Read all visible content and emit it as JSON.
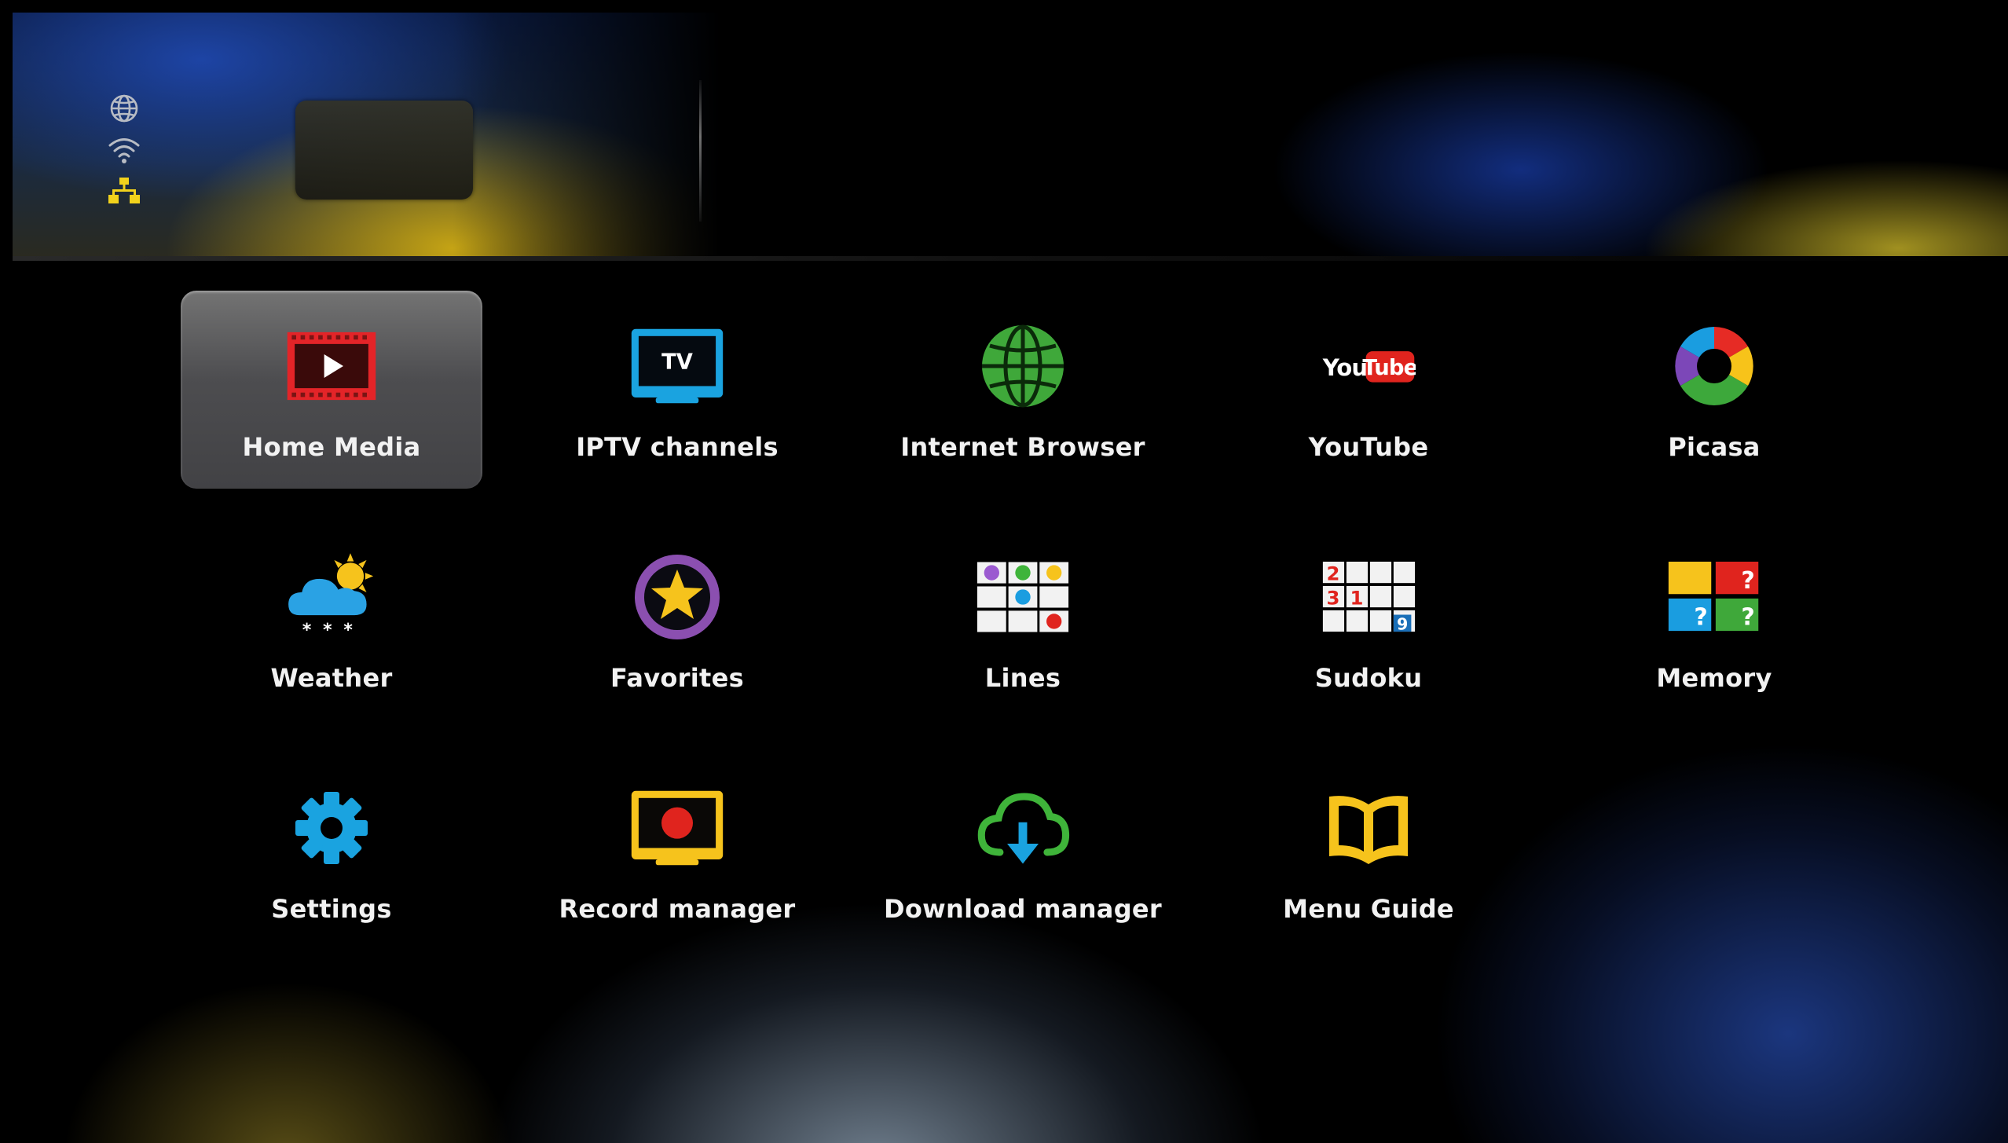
{
  "colors": {
    "background": "#000000",
    "label": "#f2f2f2",
    "status_icon_gray": "#b8bcc4",
    "status_icon_yellow": "#f2d21c"
  },
  "status_bar": {
    "icons": [
      "globe-icon",
      "wifi-icon",
      "network-icon"
    ]
  },
  "apps": [
    {
      "id": "home-media",
      "label": "Home Media",
      "icon": "film-play-icon",
      "selected": true
    },
    {
      "id": "iptv-channels",
      "label": "IPTV channels",
      "icon": "tv-icon",
      "icon_text": "TV",
      "selected": false
    },
    {
      "id": "internet-browser",
      "label": "Internet Browser",
      "icon": "globe-icon",
      "selected": false
    },
    {
      "id": "youtube",
      "label": "YouTube",
      "icon": "youtube-logo-icon",
      "icon_text": "You",
      "icon_text_2": "Tube",
      "selected": false
    },
    {
      "id": "picasa",
      "label": "Picasa",
      "icon": "picasa-logo-icon",
      "selected": false
    },
    {
      "id": "weather",
      "label": "Weather",
      "icon": "weather-cloud-sun-icon",
      "icon_text": "* * *",
      "selected": false
    },
    {
      "id": "favorites",
      "label": "Favorites",
      "icon": "star-icon",
      "selected": false
    },
    {
      "id": "lines",
      "label": "Lines",
      "icon": "lines-game-icon",
      "selected": false
    },
    {
      "id": "sudoku",
      "label": "Sudoku",
      "icon": "sudoku-grid-icon",
      "icon_digits": [
        "2",
        "3",
        "1",
        "9"
      ],
      "selected": false
    },
    {
      "id": "memory",
      "label": "Memory",
      "icon": "memory-cards-icon",
      "icon_text": "?",
      "selected": false
    },
    {
      "id": "settings",
      "label": "Settings",
      "icon": "gear-icon",
      "selected": false
    },
    {
      "id": "record-manager",
      "label": "Record manager",
      "icon": "record-icon",
      "selected": false
    },
    {
      "id": "download-manager",
      "label": "Download manager",
      "icon": "cloud-download-icon",
      "selected": false
    },
    {
      "id": "menu-guide",
      "label": "Menu Guide",
      "icon": "open-book-icon",
      "selected": false
    }
  ]
}
